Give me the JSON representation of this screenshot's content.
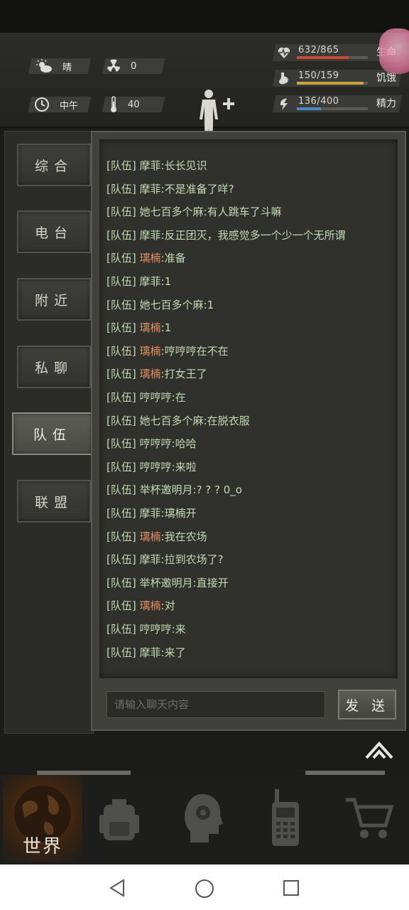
{
  "hud": {
    "weather": "晴",
    "radiation": "0",
    "time_of_day": "中午",
    "temperature": "40",
    "stats": [
      {
        "value": "632/865",
        "label": "生命",
        "fill": 0.73,
        "color": "#c94a3b",
        "icon": "heart-pulse-icon"
      },
      {
        "value": "150/159",
        "label": "饥饿",
        "fill": 0.94,
        "color": "#c9a43f",
        "icon": "stomach-icon"
      },
      {
        "value": "136/400",
        "label": "精力",
        "fill": 0.34,
        "color": "#4b86c4",
        "icon": "energy-bolt-icon"
      }
    ]
  },
  "tabs": [
    {
      "label": "综合"
    },
    {
      "label": "电台"
    },
    {
      "label": "附近"
    },
    {
      "label": "私聊"
    },
    {
      "label": "队伍",
      "active": true
    },
    {
      "label": "联盟"
    }
  ],
  "chat": {
    "messages": [
      {
        "channel": "[队伍]",
        "sender": "摩菲",
        "text": ":长长见识"
      },
      {
        "channel": "[队伍]",
        "sender": "摩菲",
        "text": ":不是准备了咩?"
      },
      {
        "channel": "[队伍]",
        "sender": "她七百多个麻",
        "text": ":有人跳车了斗嘛"
      },
      {
        "channel": "[队伍]",
        "sender": "摩菲",
        "text": ":反正团灭，我感觉多一个少一个无所谓"
      },
      {
        "channel": "[队伍]",
        "sender": "璃楠",
        "text": ":准备",
        "hl": true
      },
      {
        "channel": "[队伍]",
        "sender": "摩菲",
        "text": ":1"
      },
      {
        "channel": "[队伍]",
        "sender": "她七百多个麻",
        "text": ":1"
      },
      {
        "channel": "[队伍]",
        "sender": "璃楠",
        "text": ":1",
        "hl": true
      },
      {
        "channel": "[队伍]",
        "sender": "璃楠",
        "text": ":哼哼哼在不在",
        "hl": true
      },
      {
        "channel": "[队伍]",
        "sender": "璃楠",
        "text": ":打女王了",
        "hl": true
      },
      {
        "channel": "[队伍]",
        "sender": "哼哼哼",
        "text": ":在"
      },
      {
        "channel": "[队伍]",
        "sender": "她七百多个麻",
        "text": ":在脱衣服"
      },
      {
        "channel": "[队伍]",
        "sender": "哼哼哼",
        "text": ":哈哈"
      },
      {
        "channel": "[队伍]",
        "sender": "哼哼哼",
        "text": ":来啦"
      },
      {
        "channel": "[队伍]",
        "sender": "举杯邀明月",
        "text": ":? ? ? 0_o"
      },
      {
        "channel": "[队伍]",
        "sender": "摩菲",
        "text": ":璃楠开"
      },
      {
        "channel": "[队伍]",
        "sender": "璃楠",
        "text": ":我在农场",
        "hl": true
      },
      {
        "channel": "[队伍]",
        "sender": "摩菲",
        "text": ":拉到农场了?"
      },
      {
        "channel": "[队伍]",
        "sender": "举杯邀明月",
        "text": ":直接开"
      },
      {
        "channel": "[队伍]",
        "sender": "璃楠",
        "text": ":对",
        "hl": true
      },
      {
        "channel": "[队伍]",
        "sender": "哼哼哼",
        "text": ":来"
      },
      {
        "channel": "[队伍]",
        "sender": "摩菲",
        "text": ":来了"
      }
    ],
    "input_placeholder": "请输入聊天内容",
    "send_label": "发 送"
  },
  "bottom_nav": {
    "world_label": "世界"
  }
}
